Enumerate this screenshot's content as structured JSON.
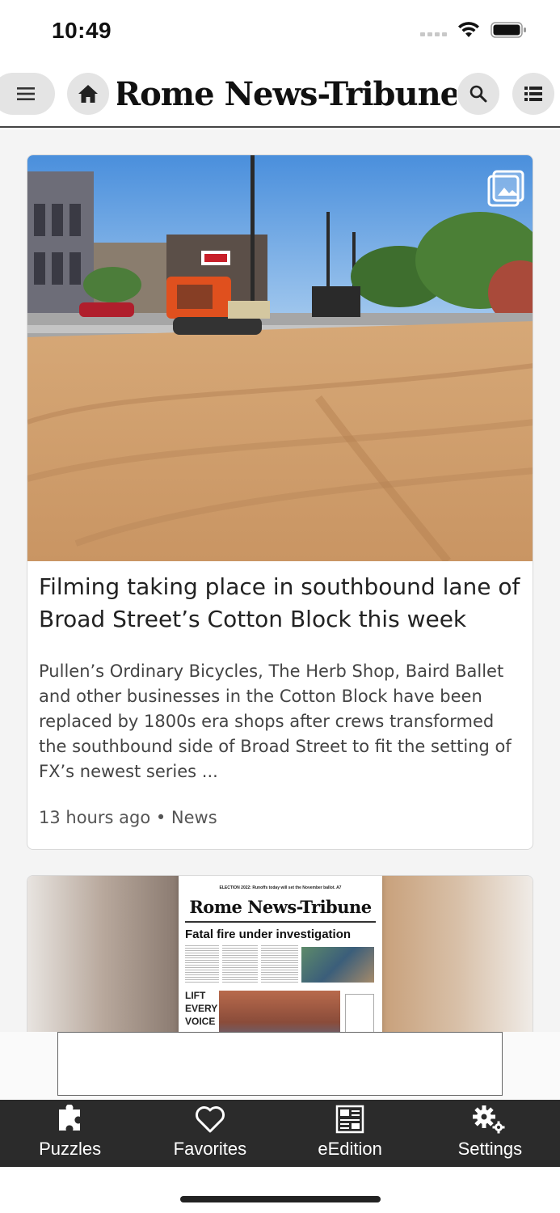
{
  "status_bar": {
    "time": "10:49"
  },
  "header": {
    "masthead": "Rome News-Tribune",
    "icons": [
      "menu-icon",
      "home-icon",
      "search-icon",
      "sections-icon"
    ]
  },
  "articles": [
    {
      "title": "Filming taking place in southbound lane of Broad Street’s Cotton Block this week",
      "summary": "Pullen’s Ordinary Bicycles, The Herb Shop, Baird Ballet and other businesses in the Cotton Block have been replaced by 1800s era shops after crews transformed the southbound side of Broad Street to fit the setting of FX’s newest series ...",
      "meta": "13 hours ago • News",
      "has_gallery": true
    },
    {
      "front_page": {
        "kicker": "ELECTION 2022: Runoffs today will set the November ballot. A7",
        "masthead": "Rome News-Tribune",
        "headline": "Fatal fire under investigation",
        "secondary": "LIFT EVERY VOICE"
      }
    }
  ],
  "bottom_nav": {
    "items": [
      {
        "label": "Puzzles",
        "icon": "puzzle-icon"
      },
      {
        "label": "Favorites",
        "icon": "heart-icon"
      },
      {
        "label": "eEdition",
        "icon": "newspaper-icon"
      },
      {
        "label": "Settings",
        "icon": "gear-icon"
      }
    ]
  },
  "colors": {
    "nav_background": "#2b2b2b",
    "page_background": "#f4f4f4",
    "header_button": "#e4e4e4"
  }
}
